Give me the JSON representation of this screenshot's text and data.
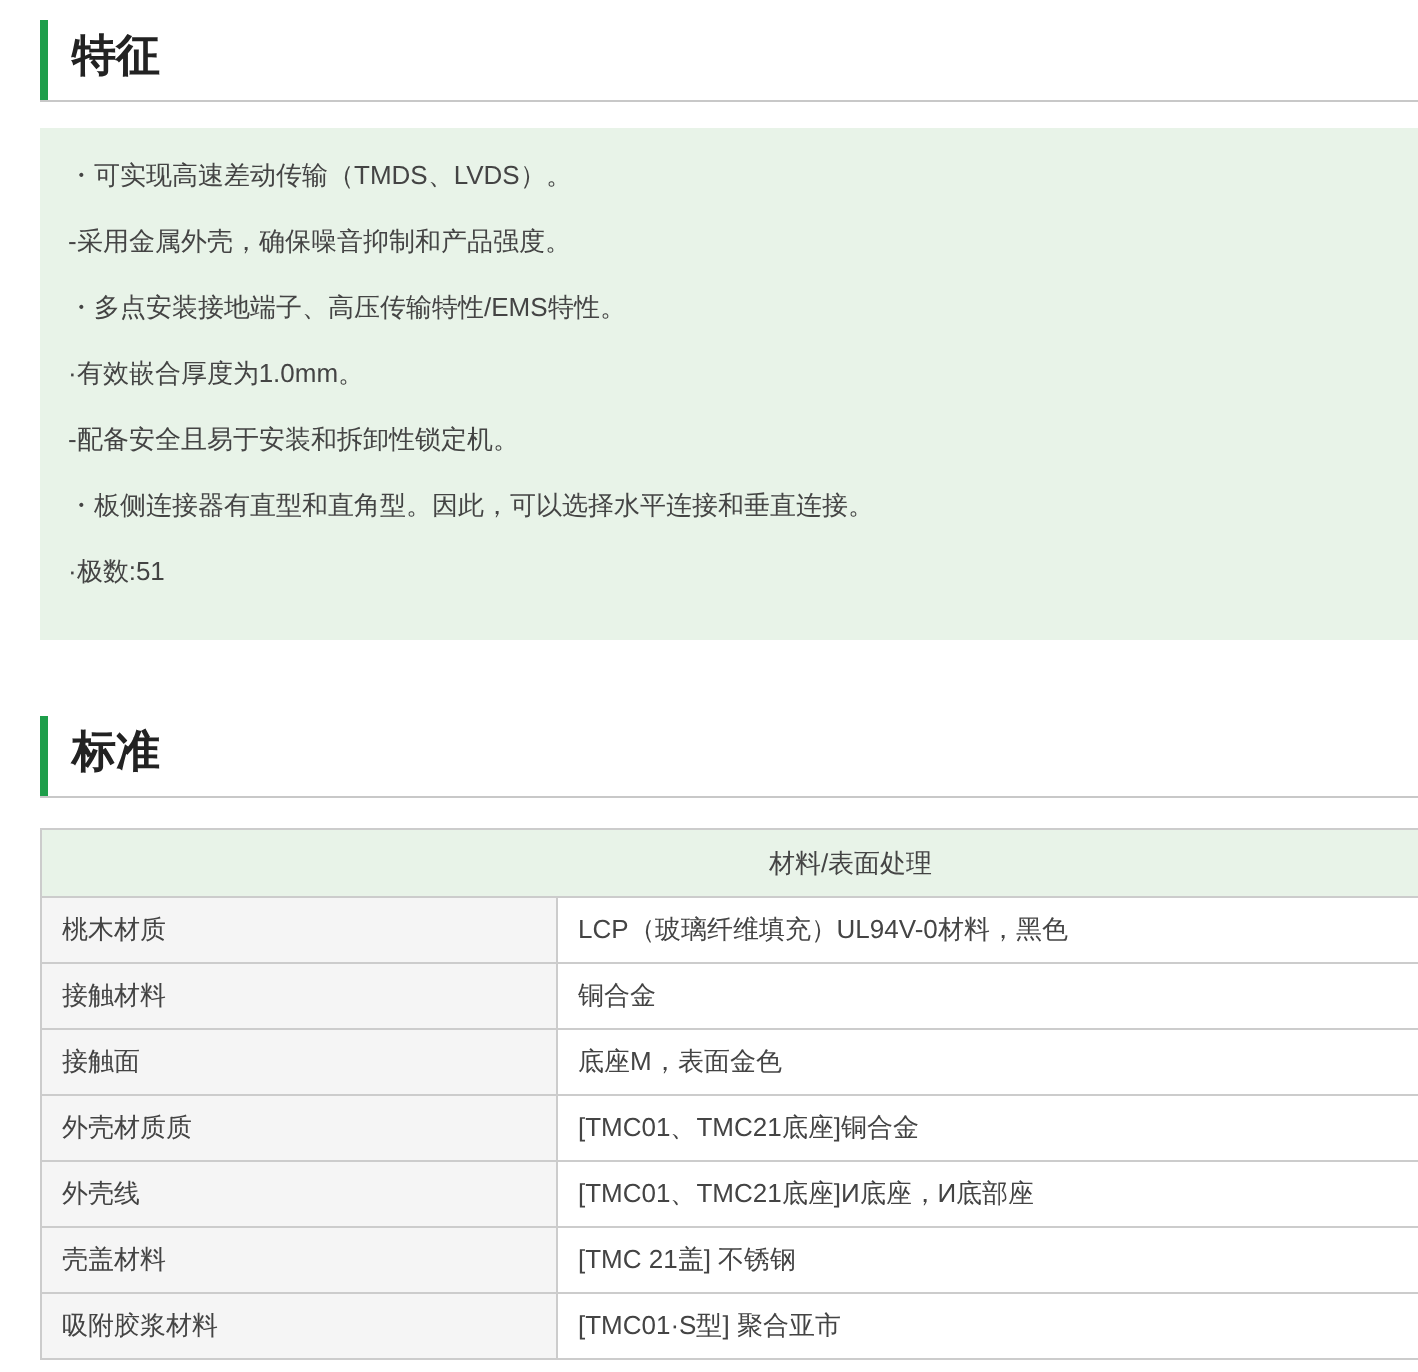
{
  "features": {
    "title": "特征",
    "items": [
      "・可实现高速差动传输（TMDS、LVDS）。",
      "-采用金属外壳，确保噪音抑制和产品强度。",
      "・多点安装接地端子、高压传输特性/EMS特性。",
      "·有效嵌合厚度为1.0mm。",
      "-配备安全且易于安装和拆卸性锁定机。",
      "・板侧连接器有直型和直角型。因此，可以选择水平连接和垂直连接。",
      "·极数:51"
    ]
  },
  "standard": {
    "title": "标准",
    "table": {
      "columns": [
        "",
        "材料/表面处理"
      ],
      "rows": [
        [
          "桃木材质",
          "LCP（玻璃纤维填充）UL94V-0材料，黑色"
        ],
        [
          "接触材料",
          "铜合金"
        ],
        [
          "接触面",
          "底座M，表面金色"
        ],
        [
          "外壳材质质",
          "[TMC01、TMC21底座]铜合金"
        ],
        [
          "外壳线",
          "[TMC01、TMC21底座]И底座，И底部座"
        ],
        [
          "壳盖材料",
          "[TMC 21盖] 不锈钢"
        ],
        [
          "吸附胶浆材料",
          "[TMC01·S型] 聚合亚市"
        ]
      ]
    }
  }
}
